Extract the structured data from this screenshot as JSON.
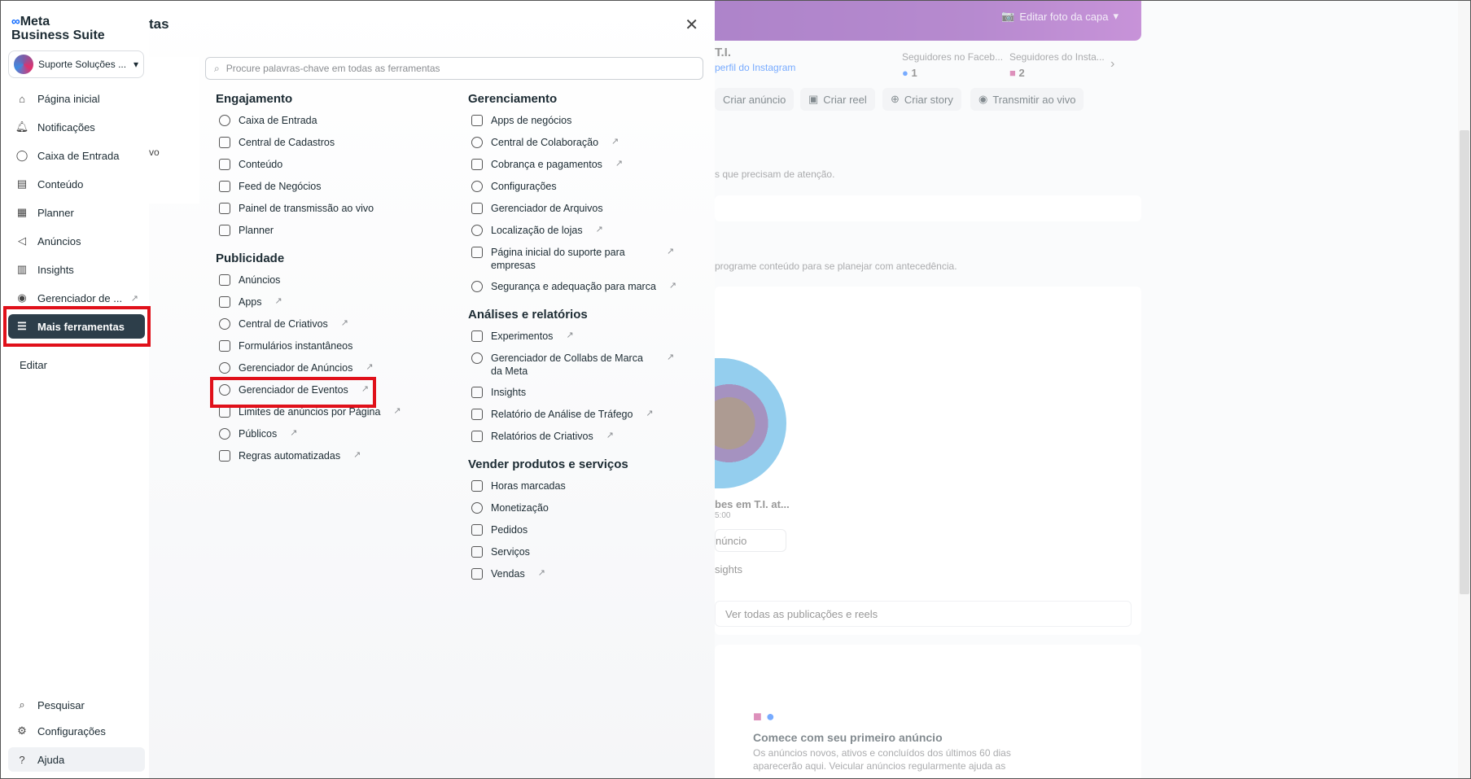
{
  "app": {
    "title_suffix": "tas"
  },
  "logo": {
    "line1": "Meta",
    "line2": "Business Suite"
  },
  "account": {
    "name": "Suporte Soluções ..."
  },
  "sidebar": {
    "items": [
      {
        "label": "Página inicial"
      },
      {
        "label": "Notificações"
      },
      {
        "label": "Caixa de Entrada"
      },
      {
        "label": "Conteúdo"
      },
      {
        "label": "Planner"
      },
      {
        "label": "Anúncios"
      },
      {
        "label": "Insights"
      },
      {
        "label": "Gerenciador de ..."
      },
      {
        "label": "Mais ferramentas"
      }
    ],
    "edit": "Editar",
    "bottom": [
      {
        "label": "Pesquisar"
      },
      {
        "label": "Configurações"
      },
      {
        "label": "Ajuda"
      }
    ]
  },
  "panel": {
    "strip_text": "vo",
    "search_placeholder": "Procure palavras-chave em todas as ferramentas",
    "sections": {
      "engajamento": {
        "title": "Engajamento",
        "items": [
          "Caixa de Entrada",
          "Central de Cadastros",
          "Conteúdo",
          "Feed de Negócios",
          "Painel de transmissão ao vivo",
          "Planner"
        ]
      },
      "publicidade": {
        "title": "Publicidade",
        "items": [
          "Anúncios",
          "Apps",
          "Central de Criativos",
          "Formulários instantâneos",
          "Gerenciador de Anúncios",
          "Gerenciador de Eventos",
          "Limites de anúncios por Página",
          "Públicos",
          "Regras automatizadas"
        ]
      },
      "gerenciamento": {
        "title": "Gerenciamento",
        "items": [
          "Apps de negócios",
          "Central de Colaboração",
          "Cobrança e pagamentos",
          "Configurações",
          "Gerenciador de Arquivos",
          "Localização de lojas",
          "Página inicial do suporte para empresas",
          "Segurança e adequação para marca"
        ]
      },
      "analises": {
        "title": "Análises e relatórios",
        "items": [
          "Experimentos",
          "Gerenciador de Collabs de Marca da Meta",
          "Insights",
          "Relatório de Análise de Tráfego",
          "Relatórios de Criativos"
        ]
      },
      "vender": {
        "title": "Vender produtos e serviços",
        "items": [
          "Horas marcadas",
          "Monetização",
          "Pedidos",
          "Serviços",
          "Vendas"
        ]
      }
    }
  },
  "background": {
    "cover_button": "Editar foto da capa",
    "page_name": "T.I.",
    "ig_link": "perfil do Instagram",
    "fb_followers_label": "Seguidores no Faceb...",
    "fb_followers": "1",
    "ig_followers_label": "Seguidores do Insta...",
    "ig_followers": "2",
    "actions": [
      "Criar anúncio",
      "Criar reel",
      "Criar story",
      "Transmitir ao vivo"
    ],
    "attention": "s que precisam de atenção.",
    "plan": "programe conteúdo para se planejar com antecedência.",
    "post_title": "bes em T.I. at...",
    "post_time": "5:00",
    "post_btn": "núncio",
    "post_insights": "sights",
    "see_all": "Ver todas as publicações e reels",
    "ad_title": "Comece com seu primeiro anúncio",
    "ad_text1": "Os anúncios novos, ativos e concluídos dos últimos 60 dias",
    "ad_text2": "aparecerão aqui. Veicular anúncios regularmente ajuda as"
  },
  "colors": {
    "accent": "#0866ff",
    "active_nav": "#2d3e4a",
    "highlight": "#e0101a"
  }
}
